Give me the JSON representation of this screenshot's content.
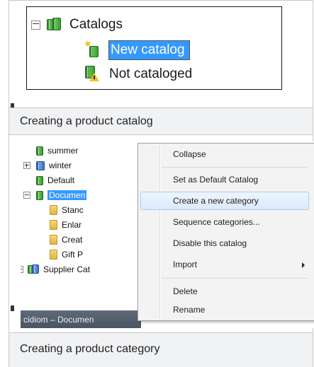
{
  "figure1": {
    "tree": {
      "root_label": "Catalogs",
      "new_item_label": "New catalog",
      "not_cataloged_label": "Not cataloged"
    },
    "caption": "Creating a product catalog"
  },
  "figure2": {
    "tree_items": [
      {
        "label": "summer",
        "expander": "",
        "icon": "catalog"
      },
      {
        "label": "winter",
        "expander": "plus",
        "icon": "catalog-blue"
      },
      {
        "label": "Default",
        "expander": "",
        "icon": "catalog"
      },
      {
        "label": "Documen",
        "expander": "minus",
        "icon": "catalog",
        "selected": true
      },
      {
        "label": "Stanc",
        "expander": "",
        "icon": "folder"
      },
      {
        "label": "Enlar",
        "expander": "",
        "icon": "folder"
      },
      {
        "label": "Creat",
        "expander": "",
        "icon": "folder"
      },
      {
        "label": "Gift P",
        "expander": "",
        "icon": "folder"
      },
      {
        "label": "Supplier Cat",
        "expander": "plus",
        "icon": "catalog-group"
      }
    ],
    "status_bar_text": "cidiom – Documen",
    "context_menu": {
      "items": [
        {
          "label": "Collapse"
        },
        {
          "label": "Set as Default Catalog"
        },
        {
          "label": "Create a new category",
          "highlighted": true
        },
        {
          "label": "Sequence categories..."
        },
        {
          "label": "Disable this catalog"
        },
        {
          "label": "Import",
          "submenu": true
        },
        {
          "label": "Delete"
        },
        {
          "label": "Rename"
        }
      ]
    },
    "caption": "Creating a product category"
  },
  "colors": {
    "caption_background": "#f1f2f4",
    "selection_blue": "#3399ff",
    "menu_background": "#f3f3f3",
    "menu_highlight_border": "#a8cdf4",
    "catalog_green": "#3c9a33",
    "warning_yellow": "#f2c21b"
  }
}
